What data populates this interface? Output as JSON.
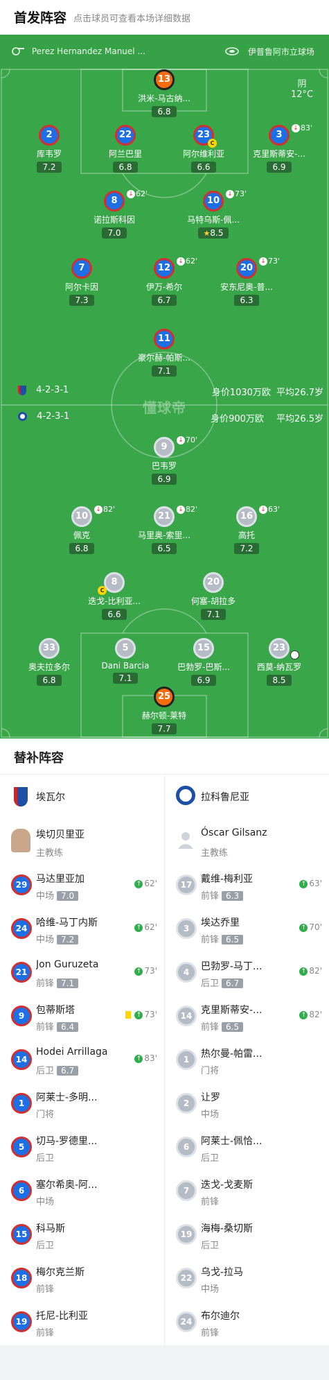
{
  "header": {
    "title": "首发阵容",
    "subtitle": "点击球员可查看本场详细数据"
  },
  "match_info": {
    "referee": "Perez Hernandez Manuel ...",
    "stadium": "伊普鲁阿市立球场",
    "weather": "阴",
    "temperature": "12°C"
  },
  "home_lineup": {
    "formation": "4-2-3-1",
    "value": "身价1030万欧",
    "avg_age": "平均26.7岁",
    "players": [
      {
        "num": "13",
        "name": "洪米-马古纳...",
        "rating": "6.8",
        "gk": true
      },
      {
        "num": "2",
        "name": "库韦罗",
        "rating": "7.2"
      },
      {
        "num": "22",
        "name": "阿兰巴里",
        "rating": "6.8"
      },
      {
        "num": "23",
        "name": "阿尔维利亚",
        "rating": "6.6",
        "captain": true
      },
      {
        "num": "3",
        "name": "克里斯蒂安-...",
        "rating": "6.9",
        "sub": "83'"
      },
      {
        "num": "8",
        "name": "诺拉斯科因",
        "rating": "7.0",
        "sub": "62'"
      },
      {
        "num": "10",
        "name": "马特乌斯-佩...",
        "rating": "8.5",
        "sub": "73'",
        "star": true
      },
      {
        "num": "7",
        "name": "阿尔卡因",
        "rating": "7.3"
      },
      {
        "num": "12",
        "name": "伊万-希尔",
        "rating": "6.7",
        "sub": "62'"
      },
      {
        "num": "20",
        "name": "安东尼奥-普...",
        "rating": "6.3",
        "sub": "73'"
      },
      {
        "num": "11",
        "name": "豪尔赫-帕斯...",
        "rating": "7.1"
      }
    ]
  },
  "away_lineup": {
    "formation": "4-2-3-1",
    "value": "身价900万欧",
    "avg_age": "平均26.5岁",
    "players": [
      {
        "num": "9",
        "name": "巴韦罗",
        "rating": "6.9",
        "sub": "70'"
      },
      {
        "num": "10",
        "name": "佩克",
        "rating": "6.8",
        "sub": "82'"
      },
      {
        "num": "21",
        "name": "马里奥-索里...",
        "rating": "6.5",
        "sub": "82'"
      },
      {
        "num": "16",
        "name": "高托",
        "rating": "7.2",
        "sub": "63'"
      },
      {
        "num": "8",
        "name": "迭戈-比利亚...",
        "rating": "6.6",
        "captain": true
      },
      {
        "num": "20",
        "name": "何塞-胡拉多",
        "rating": "7.1"
      },
      {
        "num": "33",
        "name": "奥夫拉多尔",
        "rating": "6.8"
      },
      {
        "num": "5",
        "name": "Dani Barcia",
        "rating": "7.1"
      },
      {
        "num": "15",
        "name": "巴勃罗-巴斯...",
        "rating": "6.9"
      },
      {
        "num": "23",
        "name": "西莫-纳瓦罗",
        "rating": "8.5",
        "goal": true
      },
      {
        "num": "25",
        "name": "赫尔顿-莱特",
        "rating": "7.7",
        "gk": true
      }
    ]
  },
  "watermark": "懂球帝",
  "subs_section": {
    "title": "替补阵容"
  },
  "home_subs": {
    "team": "埃瓦尔",
    "coach": "埃切贝里亚",
    "coach_label": "主教练",
    "players": [
      {
        "num": "29",
        "name": "马达里亚加",
        "pos": "中场",
        "rating": "7.0",
        "in": "62'"
      },
      {
        "num": "24",
        "name": "哈维-马丁内斯",
        "pos": "中场",
        "rating": "7.2",
        "in": "62'"
      },
      {
        "num": "21",
        "name": "Jon Guruzeta",
        "pos": "前锋",
        "rating": "7.1",
        "in": "73'"
      },
      {
        "num": "9",
        "name": "包蒂斯塔",
        "pos": "前锋",
        "rating": "6.4",
        "in": "73'",
        "yellow": true
      },
      {
        "num": "14",
        "name": "Hodei Arrillaga",
        "pos": "后卫",
        "rating": "6.7",
        "in": "83'"
      },
      {
        "num": "1",
        "name": "阿莱士-多明...",
        "pos": "门将"
      },
      {
        "num": "5",
        "name": "切马-罗德里...",
        "pos": "后卫"
      },
      {
        "num": "6",
        "name": "塞尔希奥-阿...",
        "pos": "中场"
      },
      {
        "num": "15",
        "name": "科马斯",
        "pos": "后卫"
      },
      {
        "num": "18",
        "name": "梅尔克兰斯",
        "pos": "前锋"
      },
      {
        "num": "19",
        "name": "托尼-比利亚",
        "pos": "前锋"
      }
    ]
  },
  "away_subs": {
    "team": "拉科鲁尼亚",
    "coach": "Óscar Gilsanz",
    "coach_label": "主教练",
    "players": [
      {
        "num": "17",
        "name": "戴维-梅利亚",
        "pos": "前锋",
        "rating": "6.3",
        "in": "63'"
      },
      {
        "num": "3",
        "name": "埃达乔里",
        "pos": "前锋",
        "rating": "6.5",
        "in": "70'"
      },
      {
        "num": "4",
        "name": "巴勃罗-马丁...",
        "pos": "后卫",
        "rating": "6.7",
        "in": "82'"
      },
      {
        "num": "14",
        "name": "克里斯蒂安-...",
        "pos": "前锋",
        "rating": "6.5",
        "in": "82'"
      },
      {
        "num": "1",
        "name": "热尔曼-帕雷...",
        "pos": "门将"
      },
      {
        "num": "2",
        "name": "让罗",
        "pos": "中场"
      },
      {
        "num": "6",
        "name": "阿莱士-佩恰...",
        "pos": "后卫"
      },
      {
        "num": "7",
        "name": "迭戈-戈麦斯",
        "pos": "前锋"
      },
      {
        "num": "19",
        "name": "海梅-桑切斯",
        "pos": "后卫"
      },
      {
        "num": "22",
        "name": "乌戈-拉马",
        "pos": "中场"
      },
      {
        "num": "24",
        "name": "布尔迪尔",
        "pos": "前锋"
      }
    ]
  }
}
